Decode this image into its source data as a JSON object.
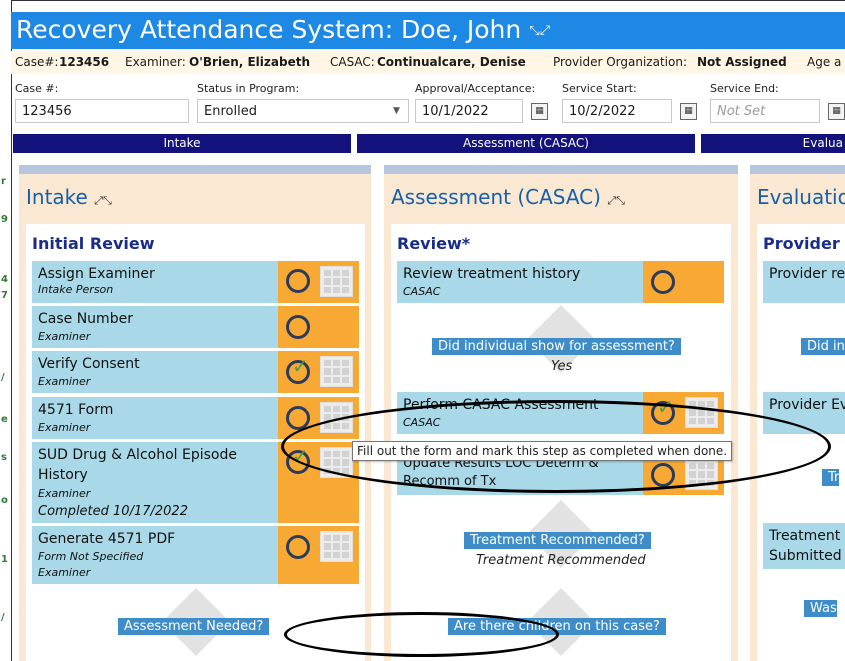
{
  "gutter_marks": [
    "r",
    "9",
    "4",
    "7",
    "/",
    "e",
    "s",
    "o",
    "1",
    "/"
  ],
  "window": {
    "title": "Recovery Attendance System: Doe, John",
    "expand_glyph": "↖↗↙↘",
    "collapse_glyph": "↘↙↗↖"
  },
  "info": {
    "case_label": "Case#:",
    "case_value": "123456",
    "examiner_label": "Examiner:",
    "examiner_value": "O'Brien, Elizabeth",
    "casac_label": "CASAC:",
    "casac_value": "Continualcare, Denise",
    "provider_label": "Provider Organization:",
    "provider_value": "Not Assigned",
    "age_label": "Age a"
  },
  "fields": {
    "case_label": "Case #:",
    "case_value": "123456",
    "status_label": "Status in Program:",
    "status_value": "Enrolled",
    "approval_label": "Approval/Acceptance:",
    "approval_value": "10/1/2022",
    "start_label": "Service Start:",
    "start_value": "10/2/2022",
    "end_label": "Service End:",
    "end_placeholder": "Not Set",
    "cal_glyph": "▦"
  },
  "phases": [
    "Intake",
    "Assessment (CASAC)",
    "Evalua"
  ],
  "intake": {
    "title": "Intake",
    "section": "Initial Review",
    "steps": [
      {
        "name": "Assign Examiner",
        "role": "Intake Person",
        "state": "open"
      },
      {
        "name": "Case Number",
        "role": "Examiner",
        "state": "open"
      },
      {
        "name": "Verify Consent",
        "role": "Examiner",
        "state": "done"
      },
      {
        "name": "4571 Form",
        "role": "Examiner",
        "state": "open"
      },
      {
        "name": "SUD Drug & Alcohol Episode History",
        "role": "Examiner",
        "extra": "Completed 10/17/2022",
        "state": "done"
      },
      {
        "name": "Generate 4571 PDF",
        "role": "Form Not Specified",
        "role2": "Examiner",
        "state": "open"
      }
    ],
    "question": "Assessment Needed?"
  },
  "assessment": {
    "title": "Assessment (CASAC)",
    "section": "Review*",
    "steps": [
      {
        "name": "Review treatment history",
        "role": "CASAC",
        "state": "open"
      },
      {
        "name": "Perform CASAC Assessment",
        "role": "CASAC",
        "state": "done"
      },
      {
        "name": "Update Results LOC Determ &",
        "name2": "Recomm of Tx",
        "state": "open"
      }
    ],
    "q1": "Did individual show for assessment?",
    "a1": "Yes",
    "q2": "Treatment Recommended?",
    "a2": "Treatment Recommended",
    "q3": "Are there children on this case?"
  },
  "evaluation": {
    "title": "Evaluation",
    "section": "Provider",
    "step1": "Provider re",
    "q1": "Did in",
    "step2": "Provider Ev",
    "q2": "Tr",
    "step3a": "Treatment",
    "step3b": "Submitted",
    "q3": "Was"
  },
  "tooltip": "Fill out the form and mark this step as completed when done.",
  "check_glyph": "✓"
}
